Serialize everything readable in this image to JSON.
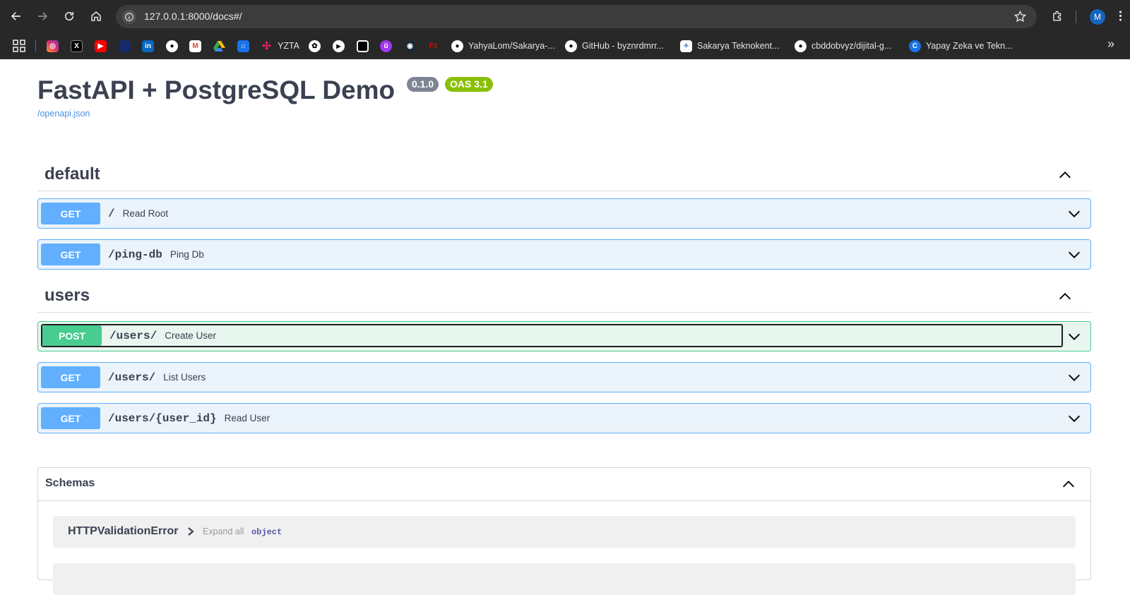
{
  "browser": {
    "url": "127.0.0.1:8000/docs#/",
    "profile_initial": "M",
    "bookmarks": [
      {
        "icon": "apps-grid-icon",
        "label": ""
      },
      {
        "icon": "instagram-icon",
        "label": ""
      },
      {
        "icon": "x-icon",
        "label": ""
      },
      {
        "icon": "youtube-icon",
        "label": ""
      },
      {
        "icon": "dark-blue-site-icon",
        "label": ""
      },
      {
        "icon": "linkedin-icon",
        "label": ""
      },
      {
        "icon": "github-icon",
        "label": ""
      },
      {
        "icon": "gmail-icon",
        "label": ""
      },
      {
        "icon": "google-drive-icon",
        "label": ""
      },
      {
        "icon": "university-icon",
        "label": ""
      },
      {
        "icon": "slack-icon",
        "label": "YZTA"
      },
      {
        "icon": "openai-icon",
        "label": ""
      },
      {
        "icon": "play-circle-icon",
        "label": ""
      },
      {
        "icon": "square-app-icon",
        "label": ""
      },
      {
        "icon": "udemy-icon",
        "label": ""
      },
      {
        "icon": "steam-icon",
        "label": ""
      },
      {
        "icon": "f1-icon",
        "label": ""
      },
      {
        "icon": "github-icon",
        "label": "YahyaLom/Sakarya-..."
      },
      {
        "icon": "github-icon",
        "label": "GitHub - byznrdmrr..."
      },
      {
        "icon": "teknokent-icon",
        "label": "Sakarya Teknokent..."
      },
      {
        "icon": "github-icon",
        "label": "cbddobvyz/dijital-g..."
      },
      {
        "icon": "c-logo-icon",
        "label": "Yapay Zeka ve Tekn..."
      }
    ]
  },
  "header": {
    "title": "FastAPI + PostgreSQL Demo",
    "version": "0.1.0",
    "oas": "OAS 3.1",
    "openapi_link": "/openapi.json"
  },
  "tags": [
    {
      "name": "default",
      "operations": [
        {
          "method": "GET",
          "path": "/",
          "summary": "Read Root"
        },
        {
          "method": "GET",
          "path": "/ping-db",
          "summary": "Ping Db"
        }
      ]
    },
    {
      "name": "users",
      "operations": [
        {
          "method": "POST",
          "path": "/users/",
          "summary": "Create User"
        },
        {
          "method": "GET",
          "path": "/users/",
          "summary": "List Users"
        },
        {
          "method": "GET",
          "path": "/users/{user_id}",
          "summary": "Read User"
        }
      ]
    }
  ],
  "schemas": {
    "title": "Schemas",
    "models": [
      {
        "name": "HTTPValidationError",
        "expand_label": "Expand all",
        "type": "object"
      },
      {
        "name": "",
        "expand_label": "",
        "type": ""
      }
    ]
  },
  "colors": {
    "get": "#61affe",
    "post": "#49cc90",
    "oas_badge": "#89bf04",
    "version_badge": "#7d8492"
  }
}
